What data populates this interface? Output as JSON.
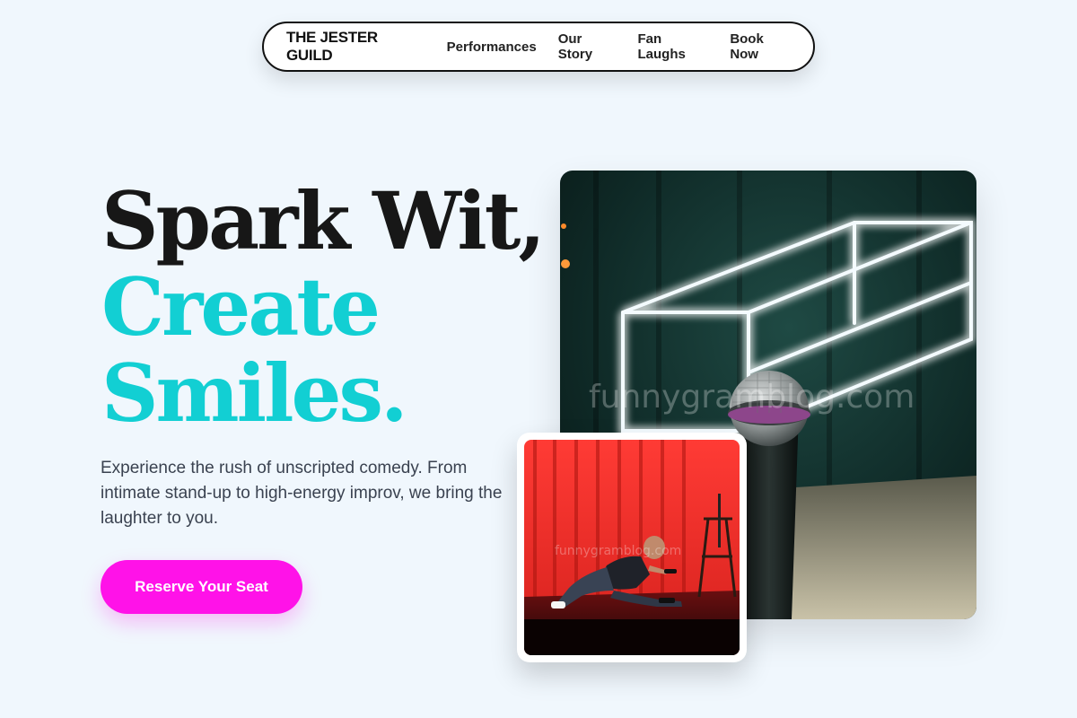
{
  "nav": {
    "brand": "THE JESTER GUILD",
    "links": [
      "Performances",
      "Our Story",
      "Fan Laughs",
      "Book Now"
    ]
  },
  "hero": {
    "headline_line1": "Spark Wit,",
    "headline_line2": "Create",
    "headline_line3": "Smiles.",
    "subtext": "Experience the rush of unscripted comedy. From intimate stand-up to high-energy improv, we bring the laughter to you.",
    "cta_label": "Reserve Your Seat"
  },
  "images": {
    "main_watermark": "funnygramblog.com",
    "small_watermark": "funnygramblog.com"
  },
  "colors": {
    "background": "#f0f7fd",
    "accent_teal": "#12cfd3",
    "accent_magenta": "#ff12e8",
    "text_dark": "#171717"
  }
}
